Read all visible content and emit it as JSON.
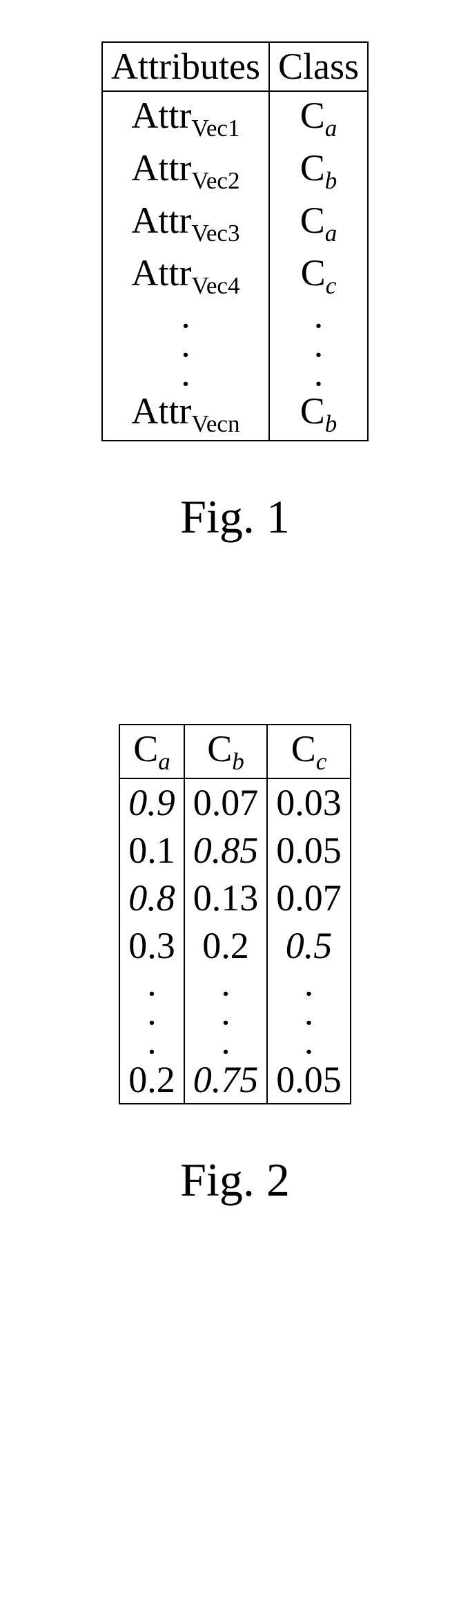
{
  "fig1": {
    "caption": "Fig. 1",
    "headers": [
      "Attributes",
      "Class"
    ],
    "rows": [
      {
        "attr_base": "Attr",
        "attr_sub": "Vec1",
        "cls_base": "C",
        "cls_sub": "a"
      },
      {
        "attr_base": "Attr",
        "attr_sub": "Vec2",
        "cls_base": "C",
        "cls_sub": "b"
      },
      {
        "attr_base": "Attr",
        "attr_sub": "Vec3",
        "cls_base": "C",
        "cls_sub": "a"
      },
      {
        "attr_base": "Attr",
        "attr_sub": "Vec4",
        "cls_base": "C",
        "cls_sub": "c"
      }
    ],
    "last": {
      "attr_base": "Attr",
      "attr_sub": "Vecn",
      "cls_base": "C",
      "cls_sub": "b"
    }
  },
  "fig2": {
    "caption": "Fig. 2",
    "headers": [
      {
        "base": "C",
        "sub": "a"
      },
      {
        "base": "C",
        "sub": "b"
      },
      {
        "base": "C",
        "sub": "c"
      }
    ],
    "rows": [
      [
        {
          "v": "0.9",
          "it": true
        },
        {
          "v": "0.07",
          "it": false
        },
        {
          "v": "0.03",
          "it": false
        }
      ],
      [
        {
          "v": "0.1",
          "it": false
        },
        {
          "v": "0.85",
          "it": true
        },
        {
          "v": "0.05",
          "it": false
        }
      ],
      [
        {
          "v": "0.8",
          "it": true
        },
        {
          "v": "0.13",
          "it": false
        },
        {
          "v": "0.07",
          "it": false
        }
      ],
      [
        {
          "v": "0.3",
          "it": false
        },
        {
          "v": "0.2",
          "it": false
        },
        {
          "v": "0.5",
          "it": true
        }
      ]
    ],
    "last": [
      {
        "v": "0.2",
        "it": false
      },
      {
        "v": "0.75",
        "it": true
      },
      {
        "v": "0.05",
        "it": false
      }
    ]
  }
}
